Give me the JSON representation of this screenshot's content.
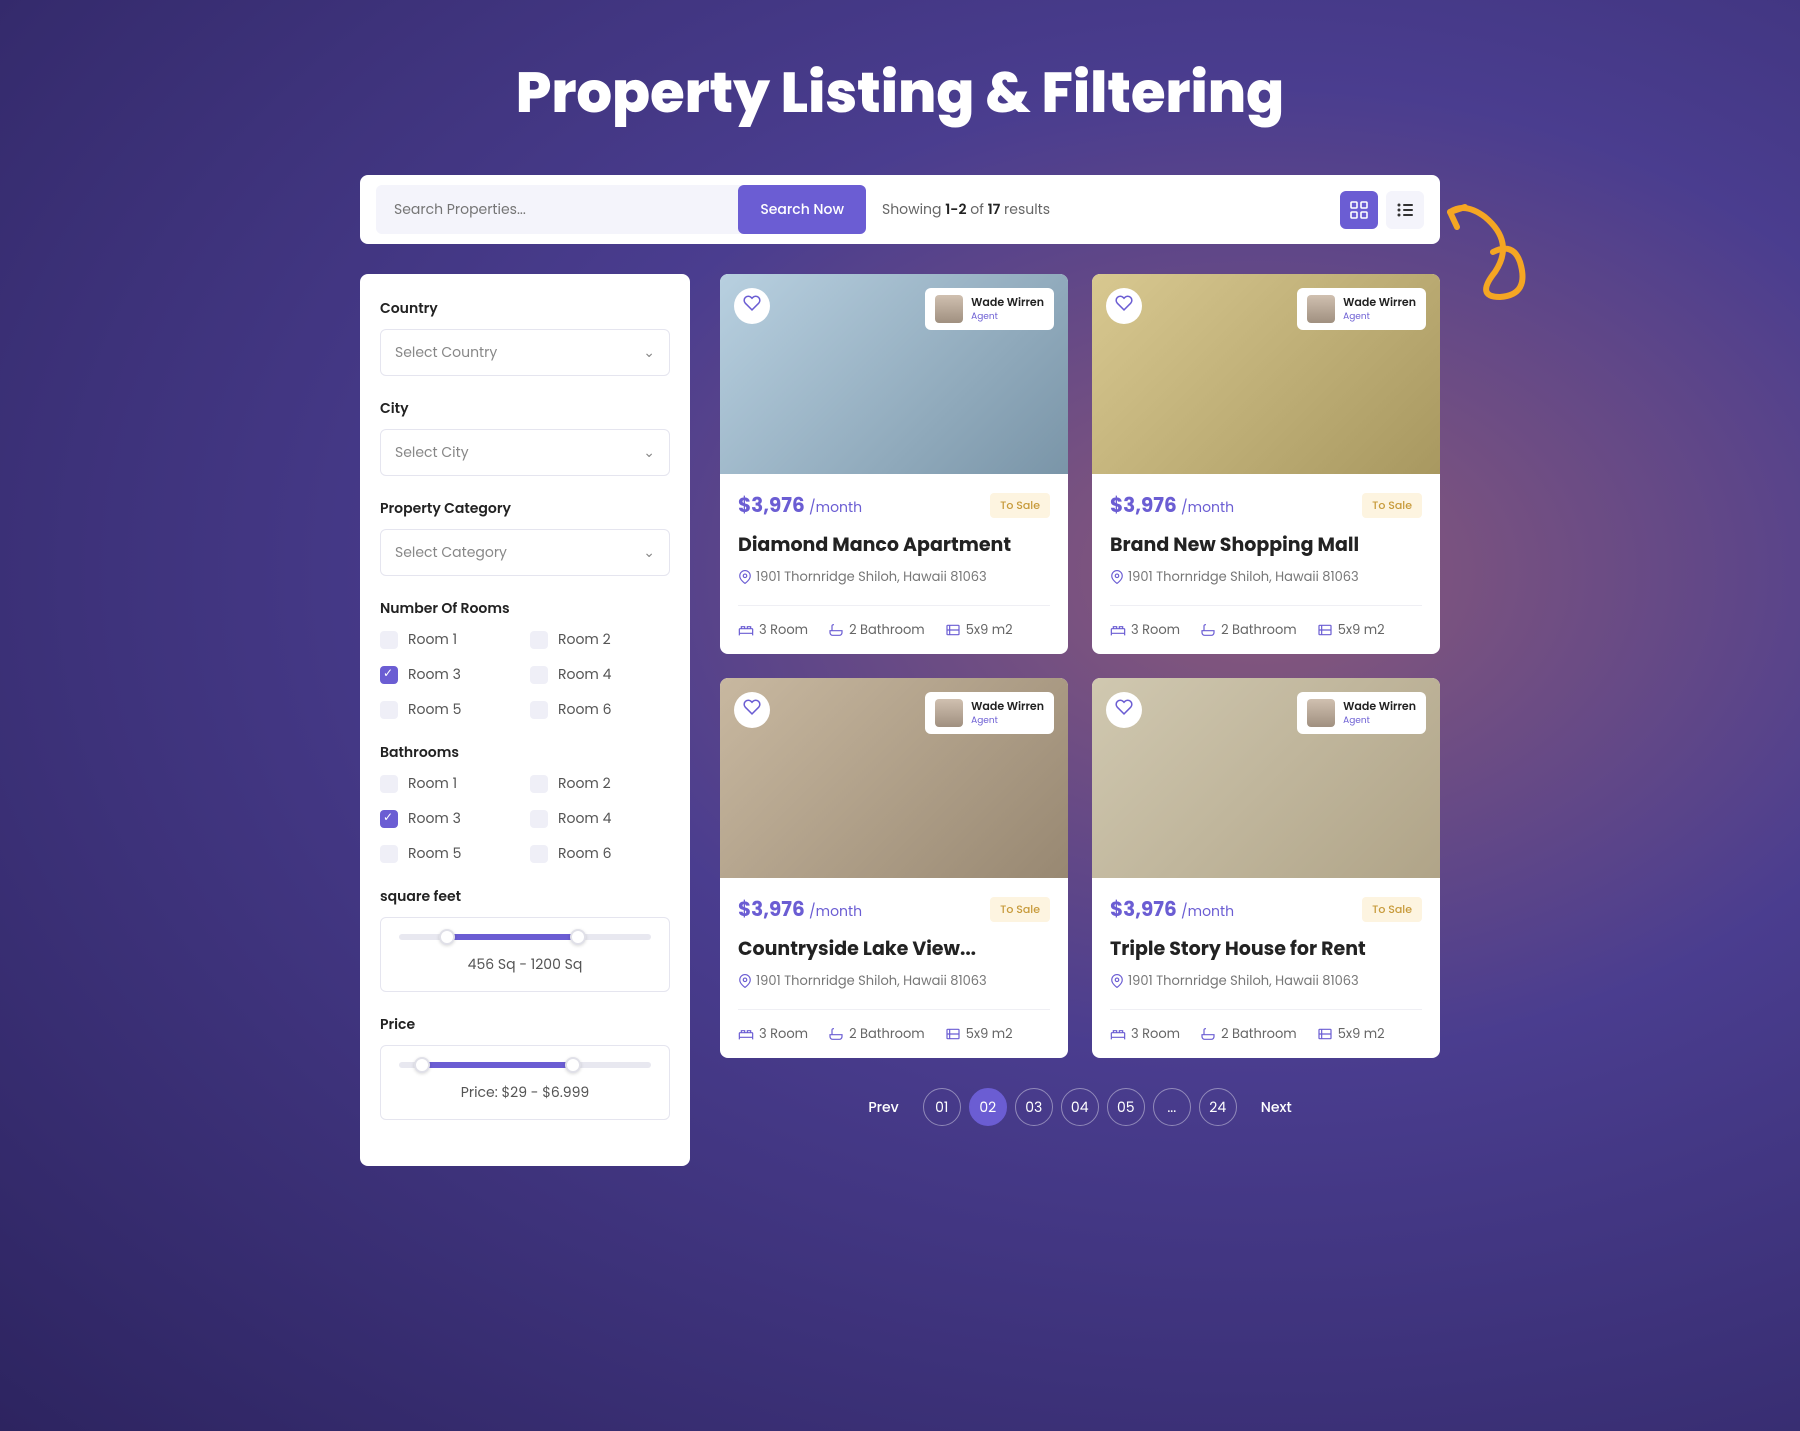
{
  "title": "Property Listing & Filtering",
  "search": {
    "placeholder": "Search Properties...",
    "button": "Search Now"
  },
  "showing": {
    "prefix": "Showing ",
    "range": "1-2",
    "mid": " of ",
    "total": "17",
    "suffix": " results"
  },
  "filters": {
    "country": {
      "label": "Country",
      "placeholder": "Select Country"
    },
    "city": {
      "label": "City",
      "placeholder": "Select City"
    },
    "category": {
      "label": "Property Category",
      "placeholder": "Select Category"
    },
    "rooms": {
      "label": "Number Of Rooms",
      "options": [
        "Room 1",
        "Room 2",
        "Room 3",
        "Room 4",
        "Room 5",
        "Room 6"
      ],
      "checked": 2
    },
    "bathrooms": {
      "label": "Bathrooms",
      "options": [
        "Room 1",
        "Room 2",
        "Room 3",
        "Room 4",
        "Room 5",
        "Room 6"
      ],
      "checked": 2
    },
    "sqft": {
      "label": "square feet",
      "text": "456 Sq - 1200 Sq"
    },
    "price": {
      "label": "Price",
      "text": "Price: $29 - $6.999"
    }
  },
  "listings": [
    {
      "price": "$3,976",
      "period": "/month",
      "tag": "To Sale",
      "title": "Diamond Manco Apartment",
      "location": "1901 Thornridge Shiloh, Hawaii 81063",
      "rooms": "3 Room",
      "baths": "2 Bathroom",
      "size": "5x9 m2",
      "agent_name": "Wade Wirren",
      "agent_role": "Agent"
    },
    {
      "price": "$3,976",
      "period": "/month",
      "tag": "To Sale",
      "title": "Brand New Shopping Mall",
      "location": "1901 Thornridge Shiloh, Hawaii 81063",
      "rooms": "3 Room",
      "baths": "2 Bathroom",
      "size": "5x9 m2",
      "agent_name": "Wade Wirren",
      "agent_role": "Agent"
    },
    {
      "price": "$3,976",
      "period": "/month",
      "tag": "To Sale",
      "title": "Countryside Lake View...",
      "location": "1901 Thornridge Shiloh, Hawaii 81063",
      "rooms": "3 Room",
      "baths": "2 Bathroom",
      "size": "5x9 m2",
      "agent_name": "Wade Wirren",
      "agent_role": "Agent"
    },
    {
      "price": "$3,976",
      "period": "/month",
      "tag": "To Sale",
      "title": "Triple Story House for Rent",
      "location": "1901 Thornridge Shiloh, Hawaii 81063",
      "rooms": "3 Room",
      "baths": "2 Bathroom",
      "size": "5x9 m2",
      "agent_name": "Wade Wirren",
      "agent_role": "Agent"
    }
  ],
  "pagination": {
    "prev": "Prev",
    "next": "Next",
    "pages": [
      "01",
      "02",
      "03",
      "04",
      "05",
      "...",
      "24"
    ],
    "active": 1
  }
}
